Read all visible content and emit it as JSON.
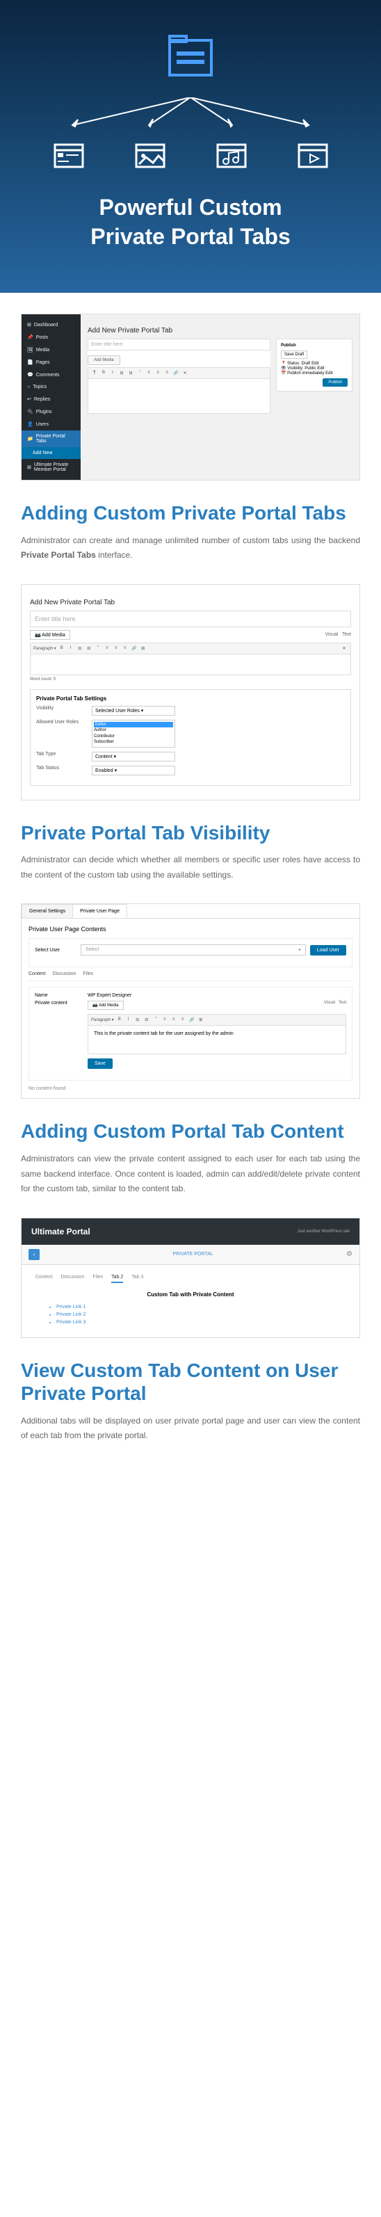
{
  "hero": {
    "title_line1": "Powerful Custom",
    "title_line2": "Private Portal Tabs"
  },
  "section1": {
    "heading": "Adding Custom Private Portal Tabs",
    "text_before": "Administrator can create and manage unlimited number of custom tabs using the backend ",
    "text_bold": "Private Portal Tabs",
    "text_after": " interface."
  },
  "mockup1": {
    "sidebar": [
      "Dashboard",
      "Posts",
      "Media",
      "Pages",
      "Comments",
      "Topics",
      "Replies",
      "Plugins",
      "Users",
      "Private Portal Tabs",
      "Add New",
      "Ultimate Private Member Portal"
    ],
    "page_title": "Add New Private Portal Tab",
    "title_placeholder": "Enter title here",
    "add_media": "Add Media",
    "publish": {
      "title": "Publish",
      "save_draft": "Save Draft",
      "status": "Status: Draft Edit",
      "visibility": "Visibility: Public Edit",
      "publish_immediately": "Publish immediately Edit",
      "button": "Publish"
    }
  },
  "section2": {
    "heading": "Private Portal Tab Visibility",
    "text": "Administrator can decide which whether all members or specific user roles have access to the content of the custom tab using the available settings."
  },
  "mockup2": {
    "page_title": "Add New Private Portal Tab",
    "title_placeholder": "Enter title here",
    "add_media": "Add Media",
    "visual": "Visual",
    "text": "Text",
    "word_count": "Word count: 0",
    "settings_title": "Private Portal Tab Settings",
    "visibility_label": "Visibility",
    "visibility_value": "Selected User Roles",
    "roles_label": "Allowed User Roles",
    "roles": [
      "Editor",
      "Author",
      "Contributor",
      "Subscriber"
    ],
    "tab_type_label": "Tab Type",
    "tab_type_value": "Content",
    "tab_status_label": "Tab Status",
    "tab_status_value": "Enabled"
  },
  "section3": {
    "heading": "Adding Custom Portal Tab Content",
    "text": "Administrators can view the private content assigned to each user for each tab using the same backend interface. Once content is loaded, admin can add/edit/delete private content for the custom tab, similar to the content tab."
  },
  "mockup3": {
    "tab1": "General Settings",
    "tab2": "Private User Page",
    "heading": "Private User Page Contents",
    "select_user_label": "Select User",
    "select_placeholder": "Select",
    "load_button": "Load User",
    "inner_tabs": [
      "Content",
      "Discussion",
      "Files"
    ],
    "name_label": "Name",
    "name_value": "WP Expert Designer",
    "private_content_label": "Private content",
    "add_media": "Add Media",
    "editor_content": "This is the private content tab for the user assigned by the admin",
    "save": "Save",
    "no_content": "No content found"
  },
  "section4": {
    "heading": "View Custom Tab Content on User Private Portal",
    "text": "Additional tabs will be displayed on user private portal page and user can view the content of each tab from the private portal."
  },
  "mockup4": {
    "brand": "Ultimate Portal",
    "subtitle": "Just another WordPress site",
    "crumb": "PRIVATE PORTAL",
    "tabs": [
      "Content",
      "Discussion",
      "Files",
      "Tab 2",
      "Tab 3"
    ],
    "content_title": "Custom Tab with Private Content",
    "links": [
      "Private Link 1",
      "Private Link 2",
      "Private Link 3"
    ]
  }
}
